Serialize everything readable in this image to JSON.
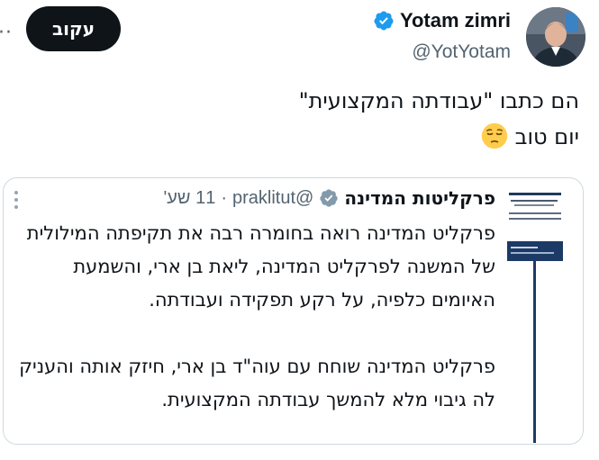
{
  "header": {
    "follow_label": "עקוב",
    "more_label": "··",
    "user": {
      "display_name": "Yotam zimri",
      "handle": "@YotYotam",
      "verified": true
    },
    "icons": [
      "more-icon",
      "verified-badge-icon",
      "avatar"
    ]
  },
  "tweet": {
    "lines": [
      "הם כתבו \"עבודתה המקצועית\"",
      "יום טוב"
    ],
    "emoji": "pensive-face-emoji"
  },
  "quote": {
    "name": "פרקליטות המדינה",
    "verified": true,
    "handle": "@praklitut",
    "separator": "·",
    "time": "11 שע'",
    "paragraph1": "פרקליט המדינה רואה בחומרה רבה את תקיפתה המילולית של המשנה לפרקליט המדינה, ליאת בן ארי, והשמעת האיומים כלפיה, על רקע תפקידה ועבודתה.",
    "paragraph2": "פרקליט המדינה שוחח עם עוה\"ד בן ארי, חיזק אותה והעניק לה גיבוי מלא להמשך עבודתה המקצועית.",
    "icons": [
      "kebab-menu-icon",
      "verified-badge-icon",
      "logo-avatar"
    ]
  },
  "colors": {
    "text": "#0f1419",
    "secondary": "#536471",
    "verified_blue": "#1d9bf0",
    "border": "#cfd9de",
    "follow_bg": "#0f1419",
    "emoji_yellow": "#ffcc4d"
  }
}
